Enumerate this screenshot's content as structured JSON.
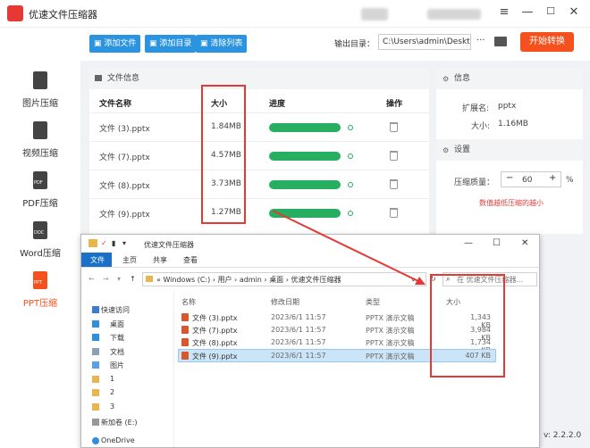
{
  "app": {
    "title": "优速文件压缩器",
    "version": "v: 2.2.2.0",
    "window_controls": [
      "≡",
      "—",
      "☐",
      "✕"
    ]
  },
  "toolbar": {
    "add_file": "添加文件",
    "add_dir": "添加目录",
    "clear_list": "清除列表",
    "output_label": "输出目录：",
    "output_path": "C:\\Users\\admin\\Deskto",
    "more": "···",
    "start": "开始转换"
  },
  "sidebar": {
    "items": [
      {
        "label": "图片压缩",
        "icon": "image-file-icon",
        "active": false
      },
      {
        "label": "视频压缩",
        "icon": "video-file-icon",
        "active": false
      },
      {
        "label": "PDF压缩",
        "icon": "pdf-file-icon",
        "active": false
      },
      {
        "label": "Word压缩",
        "icon": "doc-file-icon",
        "active": false
      },
      {
        "label": "PPT压缩",
        "icon": "ppt-file-icon",
        "active": true
      }
    ],
    "icon_tags": {
      "pdf": "PDF",
      "doc": "DOC",
      "ppt": "PPT"
    }
  },
  "file_panel": {
    "header": "文件信息",
    "columns": [
      "文件名称",
      "大小",
      "进度",
      "操作"
    ],
    "rows": [
      {
        "name": "文件 (3).pptx",
        "size": "1.84MB"
      },
      {
        "name": "文件 (7).pptx",
        "size": "4.57MB"
      },
      {
        "name": "文件 (8).pptx",
        "size": "3.73MB"
      },
      {
        "name": "文件 (9).pptx",
        "size": "1.27MB"
      }
    ]
  },
  "info_panel": {
    "header": "信息",
    "ext_label": "扩展名:",
    "ext_value": "pptx",
    "size_label": "大小:",
    "size_value": "1.16MB"
  },
  "settings_panel": {
    "header": "设置",
    "quality_label": "压缩质量：",
    "quality_minus": "−",
    "quality_value": "60",
    "quality_plus": "+",
    "quality_unit": "%",
    "hint": "数值越低压缩的越小"
  },
  "explorer": {
    "title": "优速文件压缩器",
    "tabs": [
      "文件",
      "主页",
      "共享",
      "查看"
    ],
    "path": [
      "Windows (C:)",
      "用户",
      "admin",
      "桌面",
      "优速文件压缩器"
    ],
    "search_placeholder": "在 优速文件压缩器...",
    "nav": [
      "快速访问",
      "桌面",
      "下载",
      "文档",
      "图片",
      "1",
      "2",
      "3",
      "新加卷 (E:)",
      "OneDrive"
    ],
    "columns": [
      "名称",
      "修改日期",
      "类型",
      "大小"
    ],
    "files": [
      {
        "name": "文件 (3).pptx",
        "date": "2023/6/1 11:57",
        "type": "PPTX 演示文稿",
        "size": "1,343 KB"
      },
      {
        "name": "文件 (7).pptx",
        "date": "2023/6/1 11:57",
        "type": "PPTX 演示文稿",
        "size": "3,984 KB"
      },
      {
        "name": "文件 (8).pptx",
        "date": "2023/6/1 11:57",
        "type": "PPTX 演示文稿",
        "size": "1,734 KB"
      },
      {
        "name": "文件 (9).pptx",
        "date": "2023/6/1 11:57",
        "type": "PPTX 演示文稿",
        "size": "407 KB"
      }
    ]
  },
  "colors": {
    "accent_blue": "#2b94e0",
    "start_orange": "#f5511e",
    "progress_green": "#27ae60",
    "highlight_red": "#e53935"
  }
}
